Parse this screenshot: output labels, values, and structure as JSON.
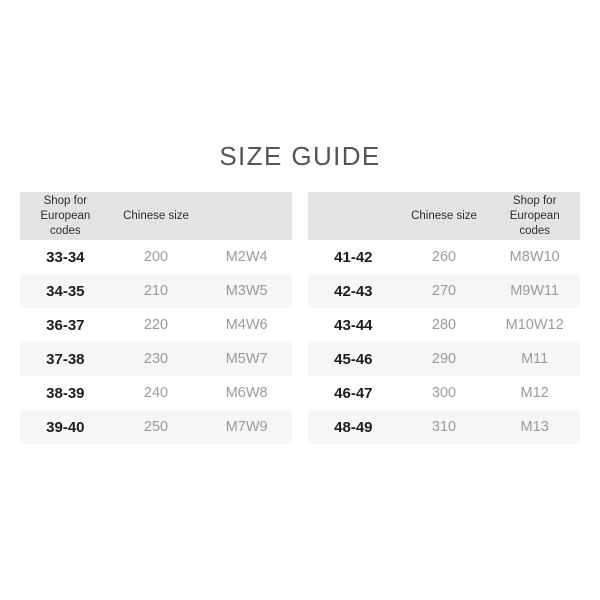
{
  "page": {
    "background_color": "#ffffff",
    "title": "SIZE GUIDE",
    "title_color": "#555555"
  },
  "colors": {
    "header_background": "#e3e3e3",
    "row_background": "#ffffff",
    "row_alt_background": "#f6f6f6",
    "primary_text": "#1d1d1d",
    "muted_text": "#9b9b9b",
    "header_text": "#2f2f2f"
  },
  "tables": [
    {
      "id": "left-size-table",
      "headers": [
        {
          "line1": "Shop for",
          "line2": "European codes"
        },
        {
          "line1": "Chinese size",
          "line2": ""
        },
        {
          "line1": "",
          "line2": ""
        }
      ],
      "rows": [
        {
          "european": "33-34",
          "chinese": "200",
          "mw": "M2W4"
        },
        {
          "european": "34-35",
          "chinese": "210",
          "mw": "M3W5"
        },
        {
          "european": "36-37",
          "chinese": "220",
          "mw": "M4W6"
        },
        {
          "european": "37-38",
          "chinese": "230",
          "mw": "M5W7"
        },
        {
          "european": "38-39",
          "chinese": "240",
          "mw": "M6W8"
        },
        {
          "european": "39-40",
          "chinese": "250",
          "mw": "M7W9"
        }
      ]
    },
    {
      "id": "right-size-table",
      "headers": [
        {
          "line1": "",
          "line2": ""
        },
        {
          "line1": "Chinese size",
          "line2": ""
        },
        {
          "line1": "Shop for",
          "line2": "European codes"
        }
      ],
      "rows": [
        {
          "european": "41-42",
          "chinese": "260",
          "mw": "M8W10"
        },
        {
          "european": "42-43",
          "chinese": "270",
          "mw": "M9W11"
        },
        {
          "european": "43-44",
          "chinese": "280",
          "mw": "M10W12"
        },
        {
          "european": "45-46",
          "chinese": "290",
          "mw": "M11"
        },
        {
          "european": "46-47",
          "chinese": "300",
          "mw": "M12"
        },
        {
          "european": "48-49",
          "chinese": "310",
          "mw": "M13"
        }
      ]
    }
  ]
}
